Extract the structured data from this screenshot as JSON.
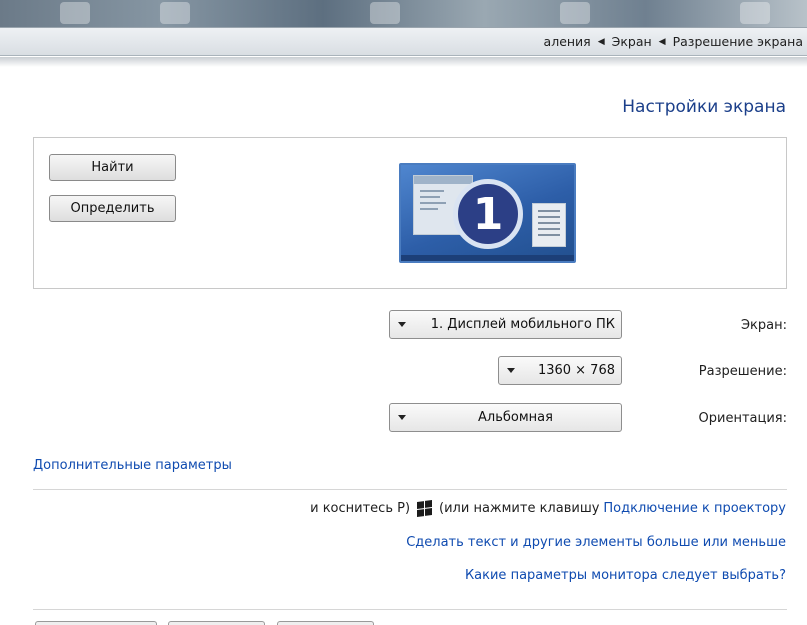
{
  "breadcrumb": {
    "items": [
      "аления",
      "Экран",
      "Разрешение экрана"
    ]
  },
  "page_title": "Настройки экрана",
  "display_panel": {
    "find_button": "Найти",
    "identify_button": "Определить",
    "monitor_number": "1"
  },
  "settings": {
    "screen_label": "Экран:",
    "screen_value": "1. Дисплей мобильного ПК",
    "resolution_label": "Разрешение:",
    "resolution_value": "1360 × 768",
    "orientation_label": "Ориентация:",
    "orientation_value": "Альбомная"
  },
  "links": {
    "advanced": "Дополнительные параметры",
    "projector": "Подключение к проектору",
    "projector_suffix_a": "(или нажмите клавишу",
    "projector_suffix_b": "и коснитесь P)",
    "text_size": "Сделать текст и другие элементы больше или меньше",
    "which_params": "Какие параметры монитора следует выбрать?"
  },
  "icons": {
    "breadcrumb_separator": "triangle-right-icon",
    "dropdown": "chevron-down-icon",
    "windows_key": "windows-logo-icon"
  },
  "colors": {
    "title": "#1b3f8a",
    "link": "#0f4bb0",
    "monitor_blue": "#2d5ea8"
  }
}
